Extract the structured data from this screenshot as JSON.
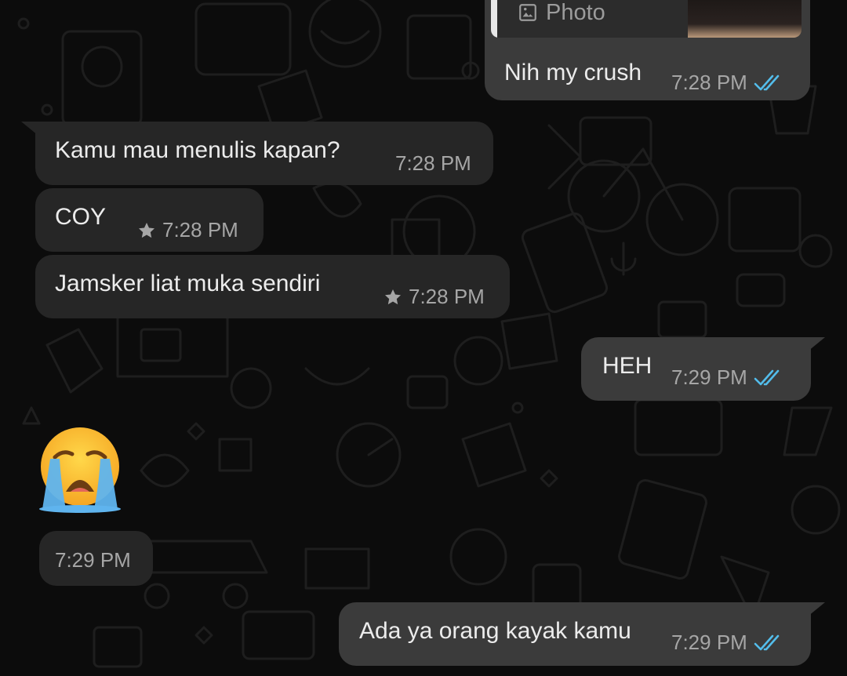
{
  "messages": [
    {
      "id": "m1",
      "direction": "outgoing",
      "text": "Nih my crush",
      "time": "7:28 PM",
      "status": "read",
      "quote": {
        "type_label": "Photo",
        "icon": "image-icon"
      }
    },
    {
      "id": "m2",
      "direction": "incoming",
      "text": "Kamu mau menulis kapan?",
      "time": "7:28 PM"
    },
    {
      "id": "m3",
      "direction": "incoming",
      "text": "COY",
      "time": "7:28 PM",
      "starred": true
    },
    {
      "id": "m4",
      "direction": "incoming",
      "text": "Jamsker liat muka sendiri",
      "time": "7:28 PM",
      "starred": true
    },
    {
      "id": "m5",
      "direction": "outgoing",
      "text": "HEH",
      "time": "7:29 PM",
      "status": "read"
    },
    {
      "id": "m6",
      "direction": "incoming",
      "emoji": "loudly-crying-face",
      "time": "7:29 PM"
    },
    {
      "id": "m7",
      "direction": "outgoing",
      "text": "Ada ya orang kayak kamu",
      "time": "7:29 PM",
      "status": "read"
    }
  ],
  "colors": {
    "background": "#0c0c0c",
    "incoming_bubble": "#262626",
    "outgoing_bubble": "#3b3b3b",
    "read_tick": "#53bdeb",
    "timestamp": "#a6a6a6"
  }
}
